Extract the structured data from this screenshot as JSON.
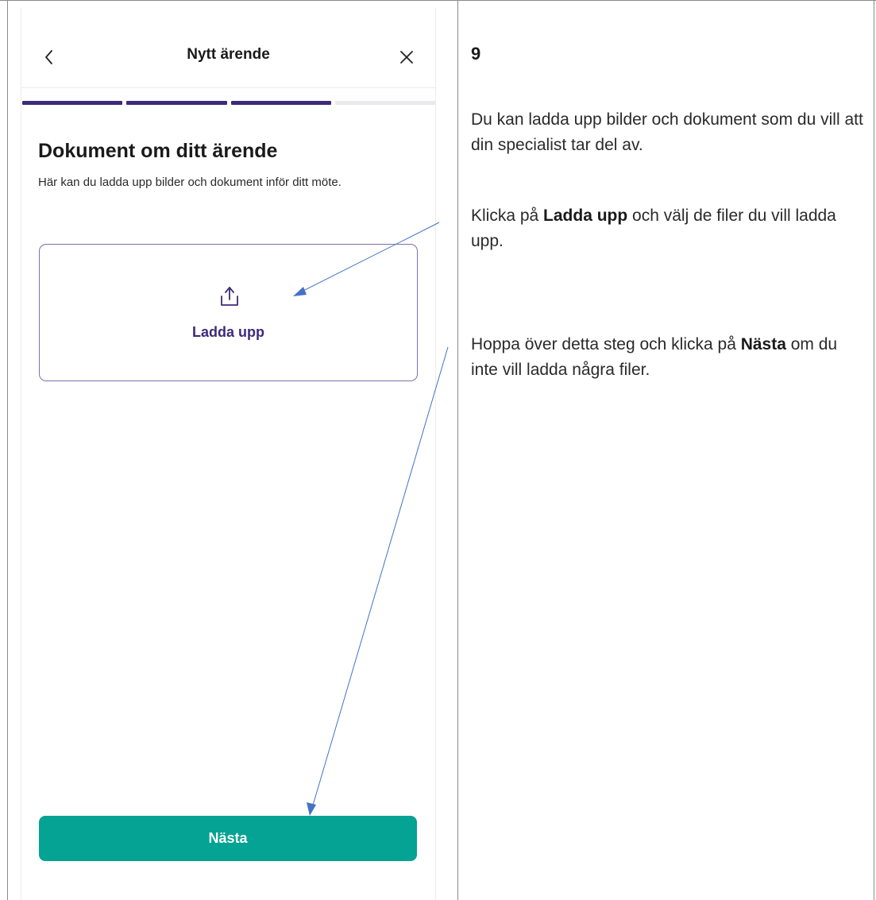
{
  "header": {
    "title": "Nytt ärende",
    "back_icon": "chevron-left-icon",
    "close_icon": "close-icon"
  },
  "progress": {
    "total_steps": 4,
    "completed_steps": 3,
    "active_color": "#3e2a7a",
    "inactive_color": "#e9e9ee"
  },
  "main": {
    "title": "Dokument om ditt ärende",
    "description": "Här kan du ladda upp bilder och dokument inför ditt möte.",
    "upload": {
      "icon": "upload-icon",
      "label": "Ladda upp"
    },
    "next_label": "Nästa"
  },
  "instructions": {
    "step_number": "9",
    "paragraph1": "Du kan ladda upp bilder och dokument som du vill att din specialist tar del av.",
    "paragraph2": {
      "before": "Klicka på ",
      "bold": "Ladda upp",
      "after": " och välj de filer du vill ladda upp."
    },
    "paragraph3": {
      "before": "Hoppa över detta steg och klicka på ",
      "bold": "Nästa",
      "after": " om du inte vill ladda några filer."
    }
  },
  "colors": {
    "brand_purple": "#3e2a7a",
    "button_teal": "#04a394",
    "annotation_arrow": "#4472c4"
  }
}
